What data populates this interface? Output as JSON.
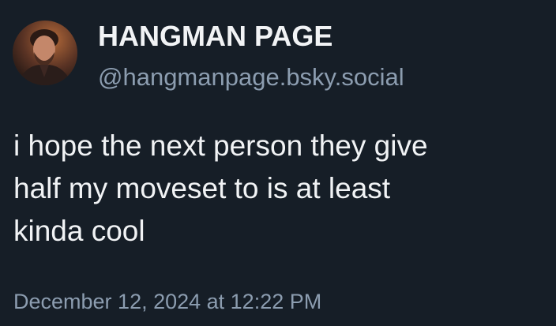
{
  "author": {
    "display_name": "HANGMAN PAGE",
    "handle": "@hangmanpage.bsky.social",
    "avatar_icon": "profile-photo"
  },
  "post": {
    "text_lines": [
      "i hope the next person they give",
      "half my moveset to is at least",
      "kinda cool"
    ],
    "timestamp": "December 12, 2024 at 12:22 PM"
  },
  "colors": {
    "background": "#161e27",
    "primary_text": "#f1f3f5",
    "secondary_text": "#8c9db0"
  }
}
